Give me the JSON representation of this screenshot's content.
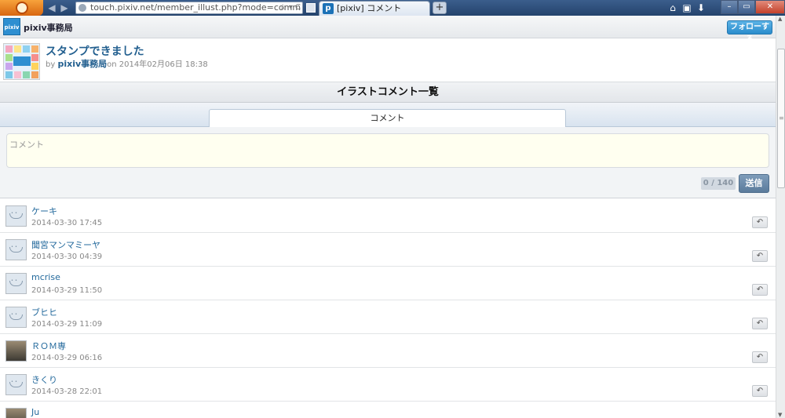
{
  "browser": {
    "url": "touch.pixiv.net/member_illust.php?mode=comm",
    "tab_title": "[pixiv] コメント",
    "new_tab": "+",
    "tab_favicon": "p",
    "nav_back": "◀",
    "nav_fwd": "▶",
    "url_tools": "☆ ▾ C",
    "toolbar_icons": [
      "home-icon",
      "download-icon",
      "sidebar-icon"
    ],
    "window": {
      "min": "–",
      "max": "▭",
      "close": "✕"
    }
  },
  "header": {
    "user_name": "pixiv事務局",
    "avatar_text": "pixiv",
    "follow_label": "フォローする"
  },
  "work": {
    "title": "スタンプできました",
    "by_label": "by",
    "author": "pixiv事務局",
    "on_label": "on",
    "date": "2014年02月06日 18:38"
  },
  "section": {
    "title": "イラストコメント一覧"
  },
  "tabs": {
    "comment_tab": "コメント"
  },
  "form": {
    "placeholder": "コメント",
    "counter": "0 / 140",
    "send_label": "送信"
  },
  "comments": [
    {
      "name": "ケーキ",
      "date": "2014-03-30 17:45"
    },
    {
      "name": "聞宮マンマミーヤ",
      "date": "2014-03-30 04:39"
    },
    {
      "name": "mcrise",
      "date": "2014-03-29 11:50"
    },
    {
      "name": "ブヒヒ",
      "date": "2014-03-29 11:09"
    },
    {
      "name": "ＲＯＭ専",
      "date": "2014-03-29 06:16"
    },
    {
      "name": "きくり",
      "date": "2014-03-28 22:01"
    },
    {
      "name": "Ju",
      "date": ""
    }
  ],
  "icons": {
    "reply": "↶",
    "scroll_up": "▲",
    "scroll_down": "▼",
    "grip": "≡"
  },
  "colors": {
    "link": "#23699c",
    "follow_button": "#2a8ccc",
    "send_button": "#5b7c9c",
    "input_bg": "#fffff0"
  }
}
